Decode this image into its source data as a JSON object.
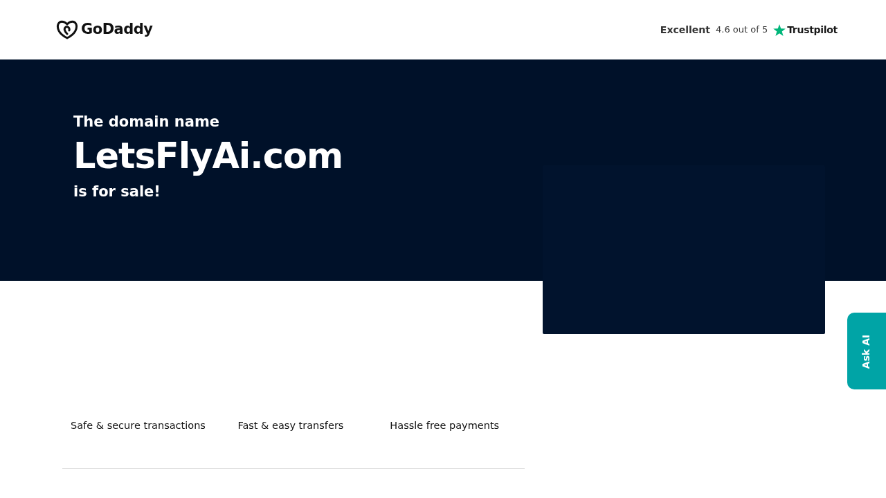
{
  "header": {
    "logo_text": "GoDaddy",
    "rating_label": "Excellent",
    "rating_score": "4.6 out of 5",
    "review_site": "Trustpilot"
  },
  "hero": {
    "lead": "The domain name",
    "domain": "LetsFlyAi.com",
    "tail": "is for sale!"
  },
  "features": [
    "Safe & secure transactions",
    "Fast & easy transfers",
    "Hassle free payments"
  ],
  "side_tab": {
    "label": "Ask AI"
  }
}
